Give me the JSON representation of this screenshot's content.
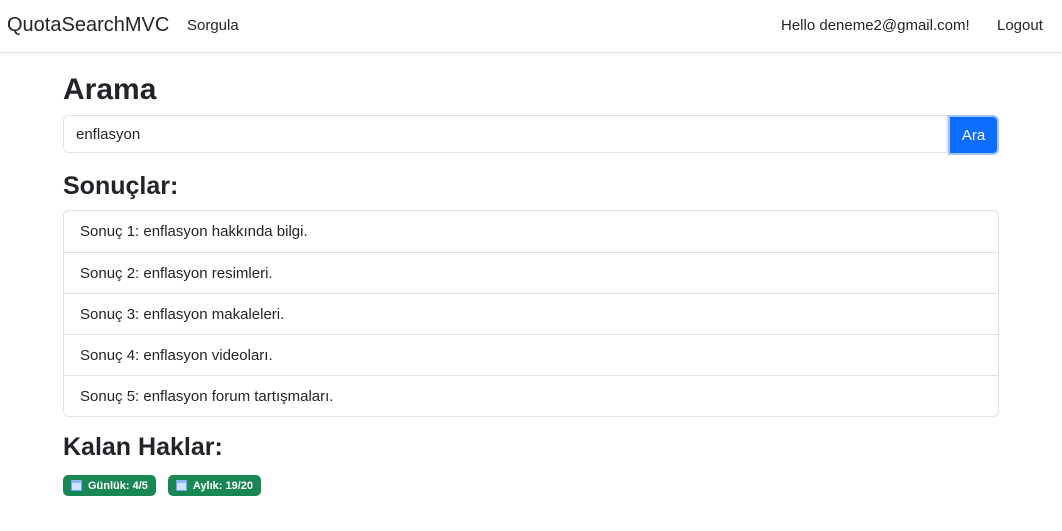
{
  "navbar": {
    "brand": "QuotaSearchMVC",
    "links": [
      {
        "label": "Sorgula"
      }
    ],
    "greeting": "Hello deneme2@gmail.com!",
    "logout_label": "Logout"
  },
  "search": {
    "title": "Arama",
    "query": "enflasyon",
    "button_label": "Ara"
  },
  "results": {
    "title": "Sonuçlar:",
    "items": [
      "Sonuç 1: enflasyon hakkında bilgi.",
      "Sonuç 2: enflasyon resimleri.",
      "Sonuç 3: enflasyon makaleleri.",
      "Sonuç 4: enflasyon videoları.",
      "Sonuç 5: enflasyon forum tartışmaları."
    ]
  },
  "quota": {
    "title": "Kalan Haklar:",
    "daily": "Günlük: 4/5",
    "monthly": "Aylık: 19/20"
  },
  "colors": {
    "primary": "#0d6efd",
    "success": "#198754",
    "border": "#dee2e6"
  }
}
